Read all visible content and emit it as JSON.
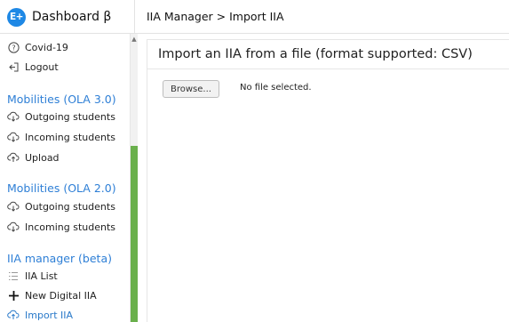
{
  "header": {
    "brand_logo": "E+",
    "brand_title": "Dashboard β",
    "breadcrumb": "IIA Manager > Import IIA"
  },
  "sidebar": {
    "top_items": [
      {
        "label": "Covid-19",
        "icon": "help-circle-icon"
      },
      {
        "label": "Logout",
        "icon": "logout-icon"
      }
    ],
    "sections": [
      {
        "title": "Mobilities (OLA 3.0)",
        "items": [
          {
            "label": "Outgoing students",
            "icon": "cloud-download-icon"
          },
          {
            "label": "Incoming students",
            "icon": "cloud-download-icon"
          },
          {
            "label": "Upload",
            "icon": "cloud-upload-icon"
          }
        ]
      },
      {
        "title": "Mobilities (OLA 2.0)",
        "items": [
          {
            "label": "Outgoing students",
            "icon": "cloud-download-icon"
          },
          {
            "label": "Incoming students",
            "icon": "cloud-download-icon"
          }
        ]
      },
      {
        "title": "IIA manager (beta)",
        "items": [
          {
            "label": "IIA List",
            "icon": "list-icon"
          },
          {
            "label": "New Digital IIA",
            "icon": "plus-icon"
          },
          {
            "label": "Import IIA",
            "icon": "cloud-upload-icon",
            "active": true
          }
        ]
      }
    ]
  },
  "main": {
    "title": "Import an IIA from a file (format supported: CSV)",
    "browse_label": "Browse...",
    "file_status": "No file selected."
  },
  "colors": {
    "accent": "#2e7fd6",
    "logo_bg": "#1e88e5",
    "scroll_thumb": "#6ab04c"
  }
}
